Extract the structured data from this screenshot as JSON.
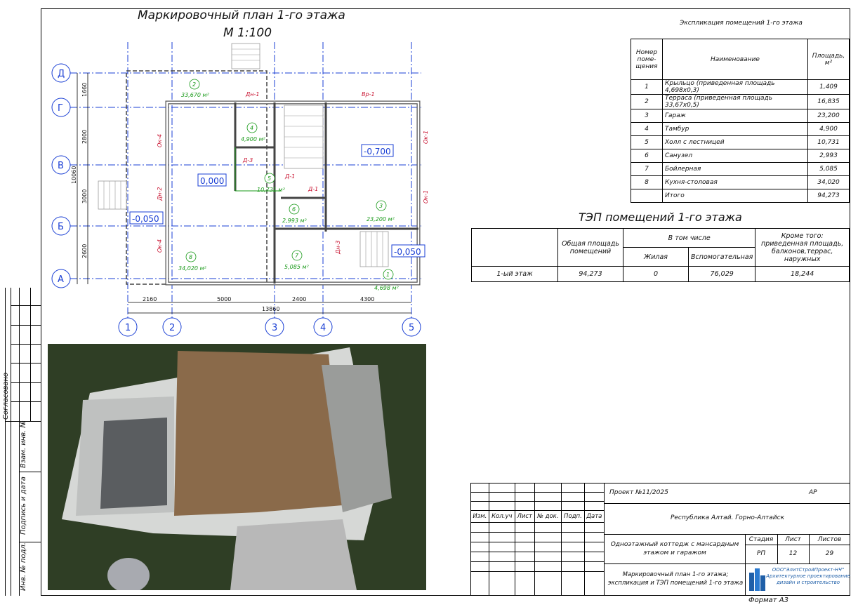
{
  "plan": {
    "title": "Маркировочный план 1-го этажа",
    "scale": "М 1:100",
    "axes_letters": [
      "Д",
      "Г",
      "В",
      "Б",
      "А"
    ],
    "axes_numbers": [
      "1",
      "2",
      "3",
      "4",
      "5"
    ],
    "dims_bottom": [
      "2160",
      "5000",
      "2400",
      "4300"
    ],
    "dim_total": "13860",
    "dims_left": [
      "1660",
      "2800",
      "3000",
      "2600"
    ],
    "dim_left_total": "10060",
    "levels": [
      "0,000",
      "-0,700",
      "-0,050",
      "-0,050"
    ],
    "rooms": [
      {
        "num": "2",
        "area": "33,670 м²"
      },
      {
        "num": "4",
        "area": "4,900 м²"
      },
      {
        "num": "5",
        "area": "10,731 м²"
      },
      {
        "num": "6",
        "area": "2,993 м²"
      },
      {
        "num": "3",
        "area": "23,200 м²"
      },
      {
        "num": "8",
        "area": "34,020 м²"
      },
      {
        "num": "7",
        "area": "5,085 м²"
      },
      {
        "num": "1",
        "area": "4,698 м²"
      }
    ],
    "marks": [
      "Дн-1",
      "Вр-1",
      "Д-3",
      "Д-1",
      "Д-1",
      "Ок-4",
      "Дн-2",
      "Ок-4",
      "Ок-1",
      "Ок-1",
      "Дн-3"
    ]
  },
  "explication": {
    "title": "Экспликация помещений  1-го этажа",
    "headers": [
      "Номер поме-щения",
      "Наименование",
      "Площадь, м²"
    ],
    "rows": [
      [
        "1",
        "Крыльцо (приведенная площадь 4,698х0,3)",
        "1,409"
      ],
      [
        "2",
        "Терраса (приведенная площадь 33,67х0,5)",
        "16,835"
      ],
      [
        "3",
        "Гараж",
        "23,200"
      ],
      [
        "4",
        "Тамбур",
        "4,900"
      ],
      [
        "5",
        "Холл с лестницей",
        "10,731"
      ],
      [
        "6",
        "Санузел",
        "2,993"
      ],
      [
        "7",
        "Бойлерная",
        "5,085"
      ],
      [
        "8",
        "Кухня-столовая",
        "34,020"
      ],
      [
        "",
        "Итого",
        "94,273"
      ]
    ]
  },
  "tep": {
    "title": "ТЭП помещений 1-го этажа",
    "h_total": "Общая площадь помещений",
    "h_including": "В том числе",
    "h_living": "Жилая",
    "h_aux": "Вспомогательная",
    "h_extra": "Кроме того: приведенная площадь, балконов,террас, наружных",
    "row": [
      "1-ый этаж",
      "94,273",
      "0",
      "76,029",
      "18,244"
    ]
  },
  "stamp": {
    "headers": [
      "Изм.",
      "Кол.уч",
      "Лист",
      "№ док.",
      "Подп.",
      "Дата"
    ],
    "project": "Проект №11/2025",
    "code": "АР",
    "location": "Республика Алтай. Горно-Алтайск",
    "object": "Одноэтажный коттедж с мансардным этажом и гаражом",
    "stage_h": "Стадия",
    "sheet_h": "Лист",
    "sheets_h": "Листов",
    "stage": "РП",
    "sheet": "12",
    "sheets": "29",
    "drawing": "Маркировочный план 1-го этажа; экспликация и ТЭП помещений 1-го этажа",
    "company": "ООО\"ЭлитСтройПроект-НЧ\" Архитектурное проектирование дизайн и строительство",
    "format": "Формат А3"
  },
  "side": {
    "agreed": "Согласовано",
    "inv_replace": "Взам. инв. №",
    "sign_date": "Подпись и дата",
    "inv_orig": "Инв. № подл."
  }
}
